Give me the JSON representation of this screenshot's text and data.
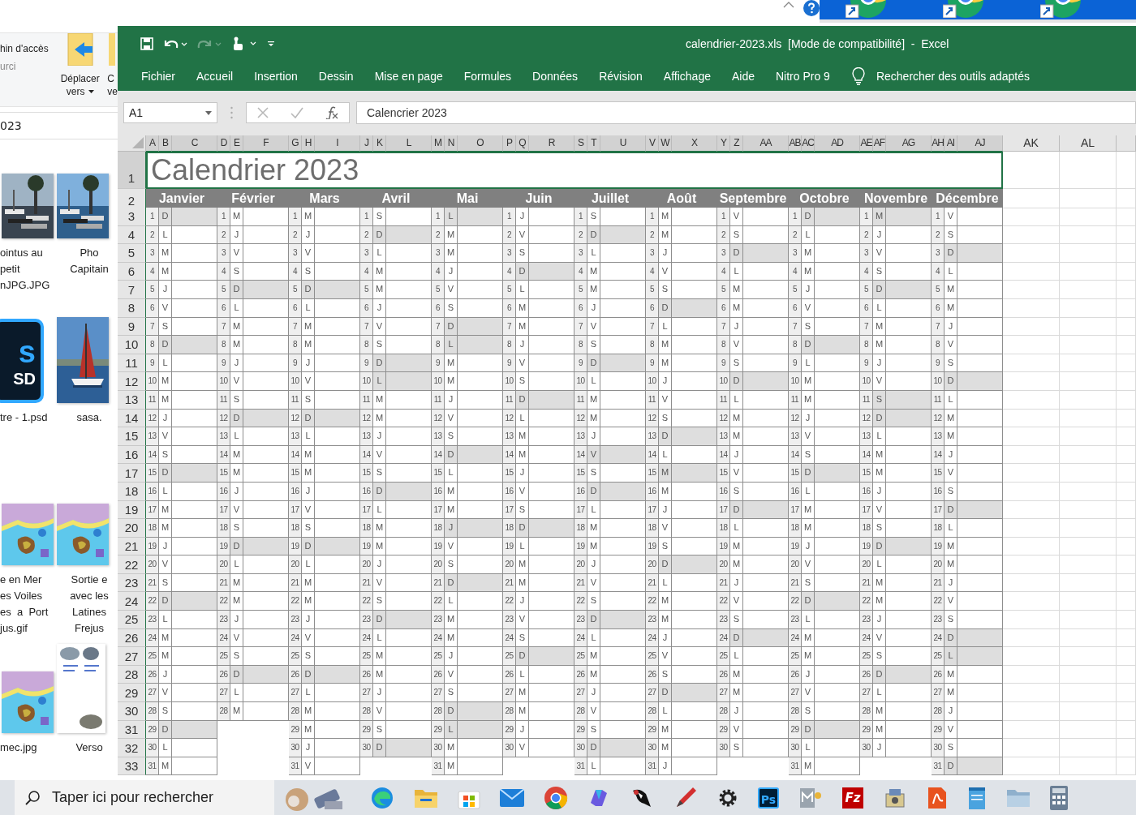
{
  "explorer": {
    "ribbon": {
      "text_1": "hin d'accès",
      "text_2": "urci",
      "move_button": [
        "Déplacer",
        "vers"
      ],
      "copy_button": [
        "C",
        "ve"
      ]
    },
    "address": "023",
    "files": [
      {
        "lines": [
          "ointus au",
          "petit",
          "nJPG.JPG"
        ]
      },
      {
        "lines": [
          "Pho",
          "Capitain"
        ]
      },
      {
        "kind": "psd",
        "badge": "s",
        "ext": "SD",
        "lines": [
          "tre - 1.psd"
        ]
      },
      {
        "kind": "sail",
        "lines": [
          "sasa."
        ]
      },
      {
        "kind": "map",
        "lines": [
          "e en Mer",
          "es Voiles",
          "es  a  Port",
          "jus.gif"
        ]
      },
      {
        "kind": "map",
        "lines": [
          "Sortie e",
          "avec les",
          "Latines",
          "Frejus"
        ]
      },
      {
        "kind": "map",
        "lines": [
          "mec.jpg"
        ]
      },
      {
        "kind": "doc",
        "lines": [
          "Verso"
        ]
      }
    ]
  },
  "excel": {
    "quick_access": [
      {
        "kind": "save",
        "disabled": false
      },
      {
        "kind": "undo",
        "disabled": false
      },
      {
        "kind": "redo",
        "disabled": true
      },
      {
        "kind": "touch",
        "disabled": false
      },
      {
        "kind": "customize",
        "disabled": false
      }
    ],
    "title": "calendrier-2023.xls  [Mode de compatibilité]  -  Excel",
    "tabs": [
      "Fichier",
      "Accueil",
      "Insertion",
      "Dessin",
      "Mise en page",
      "Formules",
      "Données",
      "Révision",
      "Affichage",
      "Aide",
      "Nitro Pro 9"
    ],
    "tell_me": "Rechercher des outils adaptés",
    "name_box": "A1",
    "formula": "Calencrier 2023",
    "columns": [
      "A",
      "B",
      "C",
      "D",
      "E",
      "F",
      "G",
      "H",
      "I",
      "J",
      "K",
      "L",
      "M",
      "N",
      "O",
      "P",
      "Q",
      "R",
      "S",
      "T",
      "U",
      "V",
      "W",
      "X",
      "Y",
      "Z",
      "AA",
      "AB",
      "AC",
      "AD",
      "AE",
      "AF",
      "AG",
      "AH",
      "AI",
      "AJ",
      "AK",
      "AL"
    ],
    "rows": [
      "1",
      "2",
      "3",
      "4",
      "5",
      "6",
      "7",
      "8",
      "9",
      "10",
      "11",
      "12",
      "13",
      "14",
      "15",
      "16",
      "17",
      "18",
      "19",
      "20",
      "21",
      "22",
      "23",
      "24",
      "25",
      "26",
      "27",
      "28",
      "29",
      "30",
      "31",
      "32",
      "33"
    ],
    "title_cell": "Calendrier 2023",
    "months": [
      {
        "name": "Janvier",
        "days": [
          {
            "n": "1",
            "d": "D",
            "off": true
          },
          {
            "n": "2",
            "d": "L",
            "off": false
          },
          {
            "n": "3",
            "d": "M",
            "off": false
          },
          {
            "n": "4",
            "d": "M",
            "off": false
          },
          {
            "n": "5",
            "d": "J",
            "off": false
          },
          {
            "n": "6",
            "d": "V",
            "off": false
          },
          {
            "n": "7",
            "d": "S",
            "off": false
          },
          {
            "n": "8",
            "d": "D",
            "off": true
          },
          {
            "n": "9",
            "d": "L",
            "off": false
          },
          {
            "n": "10",
            "d": "M",
            "off": false
          },
          {
            "n": "11",
            "d": "M",
            "off": false
          },
          {
            "n": "12",
            "d": "J",
            "off": false
          },
          {
            "n": "13",
            "d": "V",
            "off": false
          },
          {
            "n": "14",
            "d": "S",
            "off": false
          },
          {
            "n": "15",
            "d": "D",
            "off": true
          },
          {
            "n": "16",
            "d": "L",
            "off": false
          },
          {
            "n": "17",
            "d": "M",
            "off": false
          },
          {
            "n": "18",
            "d": "M",
            "off": false
          },
          {
            "n": "19",
            "d": "J",
            "off": false
          },
          {
            "n": "20",
            "d": "V",
            "off": false
          },
          {
            "n": "21",
            "d": "S",
            "off": false
          },
          {
            "n": "22",
            "d": "D",
            "off": true
          },
          {
            "n": "23",
            "d": "L",
            "off": false
          },
          {
            "n": "24",
            "d": "M",
            "off": false
          },
          {
            "n": "25",
            "d": "M",
            "off": false
          },
          {
            "n": "26",
            "d": "J",
            "off": false
          },
          {
            "n": "27",
            "d": "V",
            "off": false
          },
          {
            "n": "28",
            "d": "S",
            "off": false
          },
          {
            "n": "29",
            "d": "D",
            "off": true
          },
          {
            "n": "30",
            "d": "L",
            "off": false
          },
          {
            "n": "31",
            "d": "M",
            "off": false
          }
        ]
      },
      {
        "name": "Février",
        "days": [
          {
            "n": "1",
            "d": "M",
            "off": false
          },
          {
            "n": "2",
            "d": "J",
            "off": false
          },
          {
            "n": "3",
            "d": "V",
            "off": false
          },
          {
            "n": "4",
            "d": "S",
            "off": false
          },
          {
            "n": "5",
            "d": "D",
            "off": true
          },
          {
            "n": "6",
            "d": "L",
            "off": false
          },
          {
            "n": "7",
            "d": "M",
            "off": false
          },
          {
            "n": "8",
            "d": "M",
            "off": false
          },
          {
            "n": "9",
            "d": "J",
            "off": false
          },
          {
            "n": "10",
            "d": "V",
            "off": false
          },
          {
            "n": "11",
            "d": "S",
            "off": false
          },
          {
            "n": "12",
            "d": "D",
            "off": true
          },
          {
            "n": "13",
            "d": "L",
            "off": false
          },
          {
            "n": "14",
            "d": "M",
            "off": false
          },
          {
            "n": "15",
            "d": "M",
            "off": false
          },
          {
            "n": "16",
            "d": "J",
            "off": false
          },
          {
            "n": "17",
            "d": "V",
            "off": false
          },
          {
            "n": "18",
            "d": "S",
            "off": false
          },
          {
            "n": "19",
            "d": "D",
            "off": true
          },
          {
            "n": "20",
            "d": "L",
            "off": false
          },
          {
            "n": "21",
            "d": "M",
            "off": false
          },
          {
            "n": "22",
            "d": "M",
            "off": false
          },
          {
            "n": "23",
            "d": "J",
            "off": false
          },
          {
            "n": "24",
            "d": "V",
            "off": false
          },
          {
            "n": "25",
            "d": "S",
            "off": false
          },
          {
            "n": "26",
            "d": "D",
            "off": true
          },
          {
            "n": "27",
            "d": "L",
            "off": false
          },
          {
            "n": "28",
            "d": "M",
            "off": false
          }
        ]
      },
      {
        "name": "Mars",
        "days": [
          {
            "n": "1",
            "d": "M",
            "off": false
          },
          {
            "n": "2",
            "d": "J",
            "off": false
          },
          {
            "n": "3",
            "d": "V",
            "off": false
          },
          {
            "n": "4",
            "d": "S",
            "off": false
          },
          {
            "n": "5",
            "d": "D",
            "off": true
          },
          {
            "n": "6",
            "d": "L",
            "off": false
          },
          {
            "n": "7",
            "d": "M",
            "off": false
          },
          {
            "n": "8",
            "d": "M",
            "off": false
          },
          {
            "n": "9",
            "d": "J",
            "off": false
          },
          {
            "n": "10",
            "d": "V",
            "off": false
          },
          {
            "n": "11",
            "d": "S",
            "off": false
          },
          {
            "n": "12",
            "d": "D",
            "off": true
          },
          {
            "n": "13",
            "d": "L",
            "off": false
          },
          {
            "n": "14",
            "d": "M",
            "off": false
          },
          {
            "n": "15",
            "d": "M",
            "off": false
          },
          {
            "n": "16",
            "d": "J",
            "off": false
          },
          {
            "n": "17",
            "d": "V",
            "off": false
          },
          {
            "n": "18",
            "d": "S",
            "off": false
          },
          {
            "n": "19",
            "d": "D",
            "off": true
          },
          {
            "n": "20",
            "d": "L",
            "off": false
          },
          {
            "n": "21",
            "d": "M",
            "off": false
          },
          {
            "n": "22",
            "d": "M",
            "off": false
          },
          {
            "n": "23",
            "d": "J",
            "off": false
          },
          {
            "n": "24",
            "d": "V",
            "off": false
          },
          {
            "n": "25",
            "d": "S",
            "off": false
          },
          {
            "n": "26",
            "d": "D",
            "off": true
          },
          {
            "n": "27",
            "d": "L",
            "off": false
          },
          {
            "n": "28",
            "d": "M",
            "off": false
          },
          {
            "n": "29",
            "d": "M",
            "off": false
          },
          {
            "n": "30",
            "d": "J",
            "off": false
          },
          {
            "n": "31",
            "d": "V",
            "off": false
          }
        ]
      },
      {
        "name": "Avril",
        "days": [
          {
            "n": "1",
            "d": "S",
            "off": false
          },
          {
            "n": "2",
            "d": "D",
            "off": true
          },
          {
            "n": "3",
            "d": "L",
            "off": false
          },
          {
            "n": "4",
            "d": "M",
            "off": false
          },
          {
            "n": "5",
            "d": "M",
            "off": false
          },
          {
            "n": "6",
            "d": "J",
            "off": false
          },
          {
            "n": "7",
            "d": "V",
            "off": false
          },
          {
            "n": "8",
            "d": "S",
            "off": false
          },
          {
            "n": "9",
            "d": "D",
            "off": true
          },
          {
            "n": "10",
            "d": "L",
            "off": true
          },
          {
            "n": "11",
            "d": "M",
            "off": false
          },
          {
            "n": "12",
            "d": "M",
            "off": false
          },
          {
            "n": "13",
            "d": "J",
            "off": false
          },
          {
            "n": "14",
            "d": "V",
            "off": false
          },
          {
            "n": "15",
            "d": "S",
            "off": false
          },
          {
            "n": "16",
            "d": "D",
            "off": true
          },
          {
            "n": "17",
            "d": "L",
            "off": false
          },
          {
            "n": "18",
            "d": "M",
            "off": false
          },
          {
            "n": "19",
            "d": "M",
            "off": false
          },
          {
            "n": "20",
            "d": "J",
            "off": false
          },
          {
            "n": "21",
            "d": "V",
            "off": false
          },
          {
            "n": "22",
            "d": "S",
            "off": false
          },
          {
            "n": "23",
            "d": "D",
            "off": true
          },
          {
            "n": "24",
            "d": "L",
            "off": false
          },
          {
            "n": "25",
            "d": "M",
            "off": false
          },
          {
            "n": "26",
            "d": "M",
            "off": false
          },
          {
            "n": "27",
            "d": "J",
            "off": false
          },
          {
            "n": "28",
            "d": "V",
            "off": false
          },
          {
            "n": "29",
            "d": "S",
            "off": false
          },
          {
            "n": "30",
            "d": "D",
            "off": true
          }
        ]
      },
      {
        "name": "Mai",
        "days": [
          {
            "n": "1",
            "d": "L",
            "off": true
          },
          {
            "n": "2",
            "d": "M",
            "off": false
          },
          {
            "n": "3",
            "d": "M",
            "off": false
          },
          {
            "n": "4",
            "d": "J",
            "off": false
          },
          {
            "n": "5",
            "d": "V",
            "off": false
          },
          {
            "n": "6",
            "d": "S",
            "off": false
          },
          {
            "n": "7",
            "d": "D",
            "off": true
          },
          {
            "n": "8",
            "d": "L",
            "off": true
          },
          {
            "n": "9",
            "d": "M",
            "off": false
          },
          {
            "n": "10",
            "d": "M",
            "off": false
          },
          {
            "n": "11",
            "d": "J",
            "off": false
          },
          {
            "n": "12",
            "d": "V",
            "off": false
          },
          {
            "n": "13",
            "d": "S",
            "off": false
          },
          {
            "n": "14",
            "d": "D",
            "off": true
          },
          {
            "n": "15",
            "d": "L",
            "off": false
          },
          {
            "n": "16",
            "d": "M",
            "off": false
          },
          {
            "n": "17",
            "d": "M",
            "off": false
          },
          {
            "n": "18",
            "d": "J",
            "off": true
          },
          {
            "n": "19",
            "d": "V",
            "off": false
          },
          {
            "n": "20",
            "d": "S",
            "off": false
          },
          {
            "n": "21",
            "d": "D",
            "off": true
          },
          {
            "n": "22",
            "d": "L",
            "off": false
          },
          {
            "n": "23",
            "d": "M",
            "off": false
          },
          {
            "n": "24",
            "d": "M",
            "off": false
          },
          {
            "n": "25",
            "d": "J",
            "off": false
          },
          {
            "n": "26",
            "d": "V",
            "off": false
          },
          {
            "n": "27",
            "d": "S",
            "off": false
          },
          {
            "n": "28",
            "d": "D",
            "off": true
          },
          {
            "n": "29",
            "d": "L",
            "off": true
          },
          {
            "n": "30",
            "d": "M",
            "off": false
          },
          {
            "n": "31",
            "d": "M",
            "off": false
          }
        ]
      },
      {
        "name": "Juin",
        "days": [
          {
            "n": "1",
            "d": "J",
            "off": false
          },
          {
            "n": "2",
            "d": "V",
            "off": false
          },
          {
            "n": "3",
            "d": "S",
            "off": false
          },
          {
            "n": "4",
            "d": "D",
            "off": true
          },
          {
            "n": "5",
            "d": "L",
            "off": false
          },
          {
            "n": "6",
            "d": "M",
            "off": false
          },
          {
            "n": "7",
            "d": "M",
            "off": false
          },
          {
            "n": "8",
            "d": "J",
            "off": false
          },
          {
            "n": "9",
            "d": "V",
            "off": false
          },
          {
            "n": "10",
            "d": "S",
            "off": false
          },
          {
            "n": "11",
            "d": "D",
            "off": true
          },
          {
            "n": "12",
            "d": "L",
            "off": false
          },
          {
            "n": "13",
            "d": "M",
            "off": false
          },
          {
            "n": "14",
            "d": "M",
            "off": false
          },
          {
            "n": "15",
            "d": "J",
            "off": false
          },
          {
            "n": "16",
            "d": "V",
            "off": false
          },
          {
            "n": "17",
            "d": "S",
            "off": false
          },
          {
            "n": "18",
            "d": "D",
            "off": true
          },
          {
            "n": "19",
            "d": "L",
            "off": false
          },
          {
            "n": "20",
            "d": "M",
            "off": false
          },
          {
            "n": "21",
            "d": "M",
            "off": false
          },
          {
            "n": "22",
            "d": "J",
            "off": false
          },
          {
            "n": "23",
            "d": "V",
            "off": false
          },
          {
            "n": "24",
            "d": "S",
            "off": false
          },
          {
            "n": "25",
            "d": "D",
            "off": true
          },
          {
            "n": "26",
            "d": "L",
            "off": false
          },
          {
            "n": "27",
            "d": "M",
            "off": false
          },
          {
            "n": "28",
            "d": "M",
            "off": false
          },
          {
            "n": "29",
            "d": "J",
            "off": false
          },
          {
            "n": "30",
            "d": "V",
            "off": false
          }
        ]
      },
      {
        "name": "Juillet",
        "days": [
          {
            "n": "1",
            "d": "S",
            "off": false
          },
          {
            "n": "2",
            "d": "D",
            "off": true
          },
          {
            "n": "3",
            "d": "L",
            "off": false
          },
          {
            "n": "4",
            "d": "M",
            "off": false
          },
          {
            "n": "5",
            "d": "M",
            "off": false
          },
          {
            "n": "6",
            "d": "J",
            "off": false
          },
          {
            "n": "7",
            "d": "V",
            "off": false
          },
          {
            "n": "8",
            "d": "S",
            "off": false
          },
          {
            "n": "9",
            "d": "D",
            "off": true
          },
          {
            "n": "10",
            "d": "L",
            "off": false
          },
          {
            "n": "11",
            "d": "M",
            "off": false
          },
          {
            "n": "12",
            "d": "M",
            "off": false
          },
          {
            "n": "13",
            "d": "J",
            "off": false
          },
          {
            "n": "14",
            "d": "V",
            "off": true
          },
          {
            "n": "15",
            "d": "S",
            "off": false
          },
          {
            "n": "16",
            "d": "D",
            "off": true
          },
          {
            "n": "17",
            "d": "L",
            "off": false
          },
          {
            "n": "18",
            "d": "M",
            "off": false
          },
          {
            "n": "19",
            "d": "M",
            "off": false
          },
          {
            "n": "20",
            "d": "J",
            "off": false
          },
          {
            "n": "21",
            "d": "V",
            "off": false
          },
          {
            "n": "22",
            "d": "S",
            "off": false
          },
          {
            "n": "23",
            "d": "D",
            "off": true
          },
          {
            "n": "24",
            "d": "L",
            "off": false
          },
          {
            "n": "25",
            "d": "M",
            "off": false
          },
          {
            "n": "26",
            "d": "M",
            "off": false
          },
          {
            "n": "27",
            "d": "J",
            "off": false
          },
          {
            "n": "28",
            "d": "V",
            "off": false
          },
          {
            "n": "29",
            "d": "S",
            "off": false
          },
          {
            "n": "30",
            "d": "D",
            "off": true
          },
          {
            "n": "31",
            "d": "L",
            "off": false
          }
        ]
      },
      {
        "name": "Août",
        "days": [
          {
            "n": "1",
            "d": "M",
            "off": false
          },
          {
            "n": "2",
            "d": "M",
            "off": false
          },
          {
            "n": "3",
            "d": "J",
            "off": false
          },
          {
            "n": "4",
            "d": "V",
            "off": false
          },
          {
            "n": "5",
            "d": "S",
            "off": false
          },
          {
            "n": "6",
            "d": "D",
            "off": true
          },
          {
            "n": "7",
            "d": "L",
            "off": false
          },
          {
            "n": "8",
            "d": "M",
            "off": false
          },
          {
            "n": "9",
            "d": "M",
            "off": false
          },
          {
            "n": "10",
            "d": "J",
            "off": false
          },
          {
            "n": "11",
            "d": "V",
            "off": false
          },
          {
            "n": "12",
            "d": "S",
            "off": false
          },
          {
            "n": "13",
            "d": "D",
            "off": true
          },
          {
            "n": "14",
            "d": "L",
            "off": false
          },
          {
            "n": "15",
            "d": "M",
            "off": true
          },
          {
            "n": "16",
            "d": "M",
            "off": false
          },
          {
            "n": "17",
            "d": "J",
            "off": false
          },
          {
            "n": "18",
            "d": "V",
            "off": false
          },
          {
            "n": "19",
            "d": "S",
            "off": false
          },
          {
            "n": "20",
            "d": "D",
            "off": true
          },
          {
            "n": "21",
            "d": "L",
            "off": false
          },
          {
            "n": "22",
            "d": "M",
            "off": false
          },
          {
            "n": "23",
            "d": "M",
            "off": false
          },
          {
            "n": "24",
            "d": "J",
            "off": false
          },
          {
            "n": "25",
            "d": "V",
            "off": false
          },
          {
            "n": "26",
            "d": "S",
            "off": false
          },
          {
            "n": "27",
            "d": "D",
            "off": true
          },
          {
            "n": "28",
            "d": "L",
            "off": false
          },
          {
            "n": "29",
            "d": "M",
            "off": false
          },
          {
            "n": "30",
            "d": "M",
            "off": false
          },
          {
            "n": "31",
            "d": "J",
            "off": false
          }
        ]
      },
      {
        "name": "Septembre",
        "days": [
          {
            "n": "1",
            "d": "V",
            "off": false
          },
          {
            "n": "2",
            "d": "S",
            "off": false
          },
          {
            "n": "3",
            "d": "D",
            "off": true
          },
          {
            "n": "4",
            "d": "L",
            "off": false
          },
          {
            "n": "5",
            "d": "M",
            "off": false
          },
          {
            "n": "6",
            "d": "M",
            "off": false
          },
          {
            "n": "7",
            "d": "J",
            "off": false
          },
          {
            "n": "8",
            "d": "V",
            "off": false
          },
          {
            "n": "9",
            "d": "S",
            "off": false
          },
          {
            "n": "10",
            "d": "D",
            "off": true
          },
          {
            "n": "11",
            "d": "L",
            "off": false
          },
          {
            "n": "12",
            "d": "M",
            "off": false
          },
          {
            "n": "13",
            "d": "M",
            "off": false
          },
          {
            "n": "14",
            "d": "J",
            "off": false
          },
          {
            "n": "15",
            "d": "V",
            "off": false
          },
          {
            "n": "16",
            "d": "S",
            "off": false
          },
          {
            "n": "17",
            "d": "D",
            "off": true
          },
          {
            "n": "18",
            "d": "L",
            "off": false
          },
          {
            "n": "19",
            "d": "M",
            "off": false
          },
          {
            "n": "20",
            "d": "M",
            "off": false
          },
          {
            "n": "21",
            "d": "J",
            "off": false
          },
          {
            "n": "22",
            "d": "V",
            "off": false
          },
          {
            "n": "23",
            "d": "S",
            "off": false
          },
          {
            "n": "24",
            "d": "D",
            "off": true
          },
          {
            "n": "25",
            "d": "L",
            "off": false
          },
          {
            "n": "26",
            "d": "M",
            "off": false
          },
          {
            "n": "27",
            "d": "M",
            "off": false
          },
          {
            "n": "28",
            "d": "J",
            "off": false
          },
          {
            "n": "29",
            "d": "V",
            "off": false
          },
          {
            "n": "30",
            "d": "S",
            "off": false
          }
        ]
      },
      {
        "name": "Octobre",
        "days": [
          {
            "n": "1",
            "d": "D",
            "off": true
          },
          {
            "n": "2",
            "d": "L",
            "off": false
          },
          {
            "n": "3",
            "d": "M",
            "off": false
          },
          {
            "n": "4",
            "d": "M",
            "off": false
          },
          {
            "n": "5",
            "d": "J",
            "off": false
          },
          {
            "n": "6",
            "d": "V",
            "off": false
          },
          {
            "n": "7",
            "d": "S",
            "off": false
          },
          {
            "n": "8",
            "d": "D",
            "off": true
          },
          {
            "n": "9",
            "d": "L",
            "off": false
          },
          {
            "n": "10",
            "d": "M",
            "off": false
          },
          {
            "n": "11",
            "d": "M",
            "off": false
          },
          {
            "n": "12",
            "d": "J",
            "off": false
          },
          {
            "n": "13",
            "d": "V",
            "off": false
          },
          {
            "n": "14",
            "d": "S",
            "off": false
          },
          {
            "n": "15",
            "d": "D",
            "off": true
          },
          {
            "n": "16",
            "d": "L",
            "off": false
          },
          {
            "n": "17",
            "d": "M",
            "off": false
          },
          {
            "n": "18",
            "d": "M",
            "off": false
          },
          {
            "n": "19",
            "d": "J",
            "off": false
          },
          {
            "n": "20",
            "d": "V",
            "off": false
          },
          {
            "n": "21",
            "d": "S",
            "off": false
          },
          {
            "n": "22",
            "d": "D",
            "off": true
          },
          {
            "n": "23",
            "d": "L",
            "off": false
          },
          {
            "n": "24",
            "d": "M",
            "off": false
          },
          {
            "n": "25",
            "d": "M",
            "off": false
          },
          {
            "n": "26",
            "d": "J",
            "off": false
          },
          {
            "n": "27",
            "d": "V",
            "off": false
          },
          {
            "n": "28",
            "d": "S",
            "off": false
          },
          {
            "n": "29",
            "d": "D",
            "off": true
          },
          {
            "n": "30",
            "d": "L",
            "off": false
          },
          {
            "n": "31",
            "d": "M",
            "off": false
          }
        ]
      },
      {
        "name": "Novembre",
        "days": [
          {
            "n": "1",
            "d": "M",
            "off": true
          },
          {
            "n": "2",
            "d": "J",
            "off": false
          },
          {
            "n": "3",
            "d": "V",
            "off": false
          },
          {
            "n": "4",
            "d": "S",
            "off": false
          },
          {
            "n": "5",
            "d": "D",
            "off": true
          },
          {
            "n": "6",
            "d": "L",
            "off": false
          },
          {
            "n": "7",
            "d": "M",
            "off": false
          },
          {
            "n": "8",
            "d": "M",
            "off": false
          },
          {
            "n": "9",
            "d": "J",
            "off": false
          },
          {
            "n": "10",
            "d": "V",
            "off": false
          },
          {
            "n": "11",
            "d": "S",
            "off": true
          },
          {
            "n": "12",
            "d": "D",
            "off": true
          },
          {
            "n": "13",
            "d": "L",
            "off": false
          },
          {
            "n": "14",
            "d": "M",
            "off": false
          },
          {
            "n": "15",
            "d": "M",
            "off": false
          },
          {
            "n": "16",
            "d": "J",
            "off": false
          },
          {
            "n": "17",
            "d": "V",
            "off": false
          },
          {
            "n": "18",
            "d": "S",
            "off": false
          },
          {
            "n": "19",
            "d": "D",
            "off": true
          },
          {
            "n": "20",
            "d": "L",
            "off": false
          },
          {
            "n": "21",
            "d": "M",
            "off": false
          },
          {
            "n": "22",
            "d": "M",
            "off": false
          },
          {
            "n": "23",
            "d": "J",
            "off": false
          },
          {
            "n": "24",
            "d": "V",
            "off": false
          },
          {
            "n": "25",
            "d": "S",
            "off": false
          },
          {
            "n": "26",
            "d": "D",
            "off": true
          },
          {
            "n": "27",
            "d": "L",
            "off": false
          },
          {
            "n": "28",
            "d": "M",
            "off": false
          },
          {
            "n": "29",
            "d": "M",
            "off": false
          },
          {
            "n": "30",
            "d": "J",
            "off": false
          }
        ]
      },
      {
        "name": "Décembre",
        "days": [
          {
            "n": "1",
            "d": "V",
            "off": false
          },
          {
            "n": "2",
            "d": "S",
            "off": false
          },
          {
            "n": "3",
            "d": "D",
            "off": true
          },
          {
            "n": "4",
            "d": "L",
            "off": false
          },
          {
            "n": "5",
            "d": "M",
            "off": false
          },
          {
            "n": "6",
            "d": "M",
            "off": false
          },
          {
            "n": "7",
            "d": "J",
            "off": false
          },
          {
            "n": "8",
            "d": "V",
            "off": false
          },
          {
            "n": "9",
            "d": "S",
            "off": false
          },
          {
            "n": "10",
            "d": "D",
            "off": true
          },
          {
            "n": "11",
            "d": "L",
            "off": false
          },
          {
            "n": "12",
            "d": "M",
            "off": false
          },
          {
            "n": "13",
            "d": "M",
            "off": false
          },
          {
            "n": "14",
            "d": "J",
            "off": false
          },
          {
            "n": "15",
            "d": "V",
            "off": false
          },
          {
            "n": "16",
            "d": "S",
            "off": false
          },
          {
            "n": "17",
            "d": "D",
            "off": true
          },
          {
            "n": "18",
            "d": "L",
            "off": false
          },
          {
            "n": "19",
            "d": "M",
            "off": false
          },
          {
            "n": "20",
            "d": "M",
            "off": false
          },
          {
            "n": "21",
            "d": "J",
            "off": false
          },
          {
            "n": "22",
            "d": "V",
            "off": false
          },
          {
            "n": "23",
            "d": "S",
            "off": false
          },
          {
            "n": "24",
            "d": "D",
            "off": true
          },
          {
            "n": "25",
            "d": "L",
            "off": true
          },
          {
            "n": "26",
            "d": "M",
            "off": false
          },
          {
            "n": "27",
            "d": "M",
            "off": false
          },
          {
            "n": "28",
            "d": "J",
            "off": false
          },
          {
            "n": "29",
            "d": "V",
            "off": false
          },
          {
            "n": "30",
            "d": "S",
            "off": false
          },
          {
            "n": "31",
            "d": "D",
            "off": true
          }
        ]
      }
    ]
  },
  "taskbar": {
    "search": {
      "placeholder": "Taper ici pour rechercher"
    },
    "apps": [
      {
        "kind": "decor"
      },
      {
        "kind": "edge"
      },
      {
        "kind": "folder"
      },
      {
        "kind": "store"
      },
      {
        "kind": "mail"
      },
      {
        "kind": "chrome"
      },
      {
        "kind": "copilot"
      },
      {
        "kind": "mascot"
      },
      {
        "kind": "pen"
      },
      {
        "kind": "gear"
      },
      {
        "kind": "ps",
        "label": "Ps"
      },
      {
        "kind": "mdoc"
      },
      {
        "kind": "fz",
        "label": "Fz"
      },
      {
        "kind": "tools"
      },
      {
        "kind": "pdf"
      },
      {
        "kind": "notepad"
      },
      {
        "kind": "folder2"
      },
      {
        "kind": "calc"
      }
    ]
  }
}
